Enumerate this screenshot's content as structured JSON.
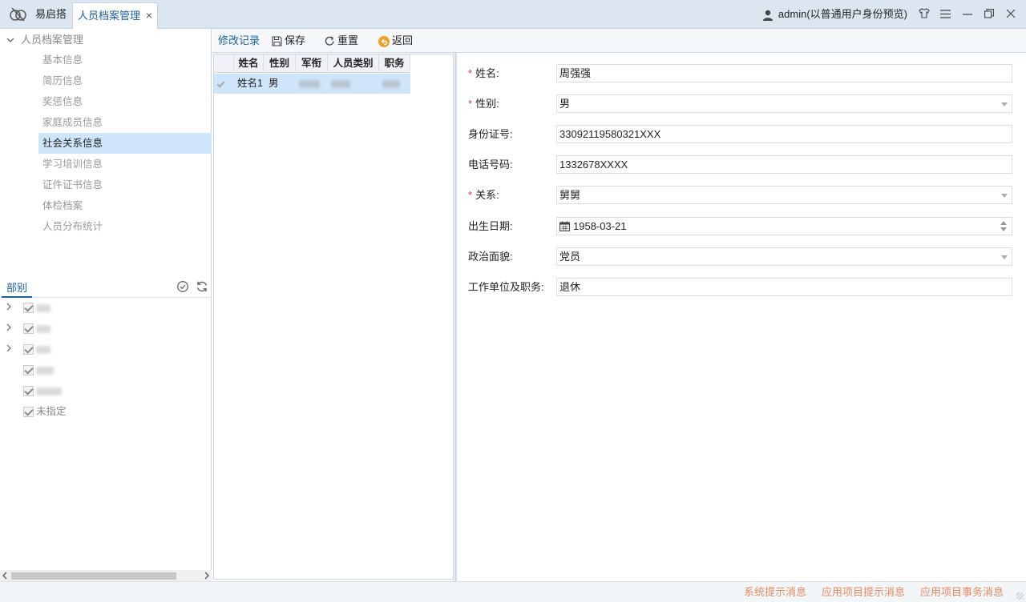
{
  "titlebar": {
    "app_name": "易启搭",
    "active_tab": "人员档案管理",
    "close_glyph": "×",
    "user": "admin(以普通用户身份预览)"
  },
  "nav": {
    "root": "人员档案管理",
    "items": [
      "基本信息",
      "简历信息",
      "奖惩信息",
      "家庭成员信息",
      "社会关系信息",
      "学习培训信息",
      "证件证书信息",
      "体检档案",
      "人员分布统计"
    ],
    "active_index": 4
  },
  "dept": {
    "title": "部别",
    "nodes": [
      {
        "label": "",
        "expandable": true
      },
      {
        "label": "",
        "expandable": true
      },
      {
        "label": "",
        "expandable": true
      },
      {
        "label": "",
        "expandable": false
      },
      {
        "label": "",
        "expandable": false
      },
      {
        "label": "未指定",
        "expandable": false
      }
    ]
  },
  "toolbar": {
    "history": "修改记录",
    "save": "保存",
    "reset": "重置",
    "back": "返回"
  },
  "grid": {
    "columns": [
      "姓名",
      "性别",
      "军衔",
      "人员类别",
      "职务"
    ],
    "rows": [
      {
        "name": "姓名1",
        "gender": "男"
      }
    ]
  },
  "form": {
    "fields": [
      {
        "label": "姓名:",
        "required": true,
        "value": "周强强",
        "type": "text"
      },
      {
        "label": "性别:",
        "required": true,
        "value": "男",
        "type": "select"
      },
      {
        "label": "身份证号:",
        "required": false,
        "value": "33092119580321XXX",
        "type": "text"
      },
      {
        "label": "电话号码:",
        "required": false,
        "value": "1332678XXXX",
        "type": "text"
      },
      {
        "label": "关系:",
        "required": true,
        "value": "舅舅",
        "type": "select"
      },
      {
        "label": "出生日期:",
        "required": false,
        "value": "1958-03-21",
        "type": "date"
      },
      {
        "label": "政治面貌:",
        "required": false,
        "value": "党员",
        "type": "select"
      },
      {
        "label": "工作单位及职务:",
        "required": false,
        "value": "退休",
        "type": "text"
      }
    ]
  },
  "status": {
    "sys_msg": "系统提示消息",
    "app_msg": "应用项目提示消息",
    "app_task": "应用项目事务消息"
  },
  "colors": {
    "accent": "#1a5fa8",
    "selection": "#cfe5fa",
    "required": "#e03a2f",
    "status_link": "#e58a63"
  }
}
